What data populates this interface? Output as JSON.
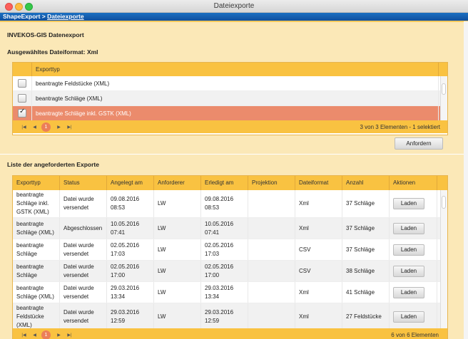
{
  "window": {
    "title": "Dateiexporte"
  },
  "breadcrumb": {
    "root": "ShapeExport",
    "sep": " > ",
    "current": "Dateiexporte"
  },
  "export": {
    "title": "INVEKOS-GIS Datenexport",
    "format_label": "Ausgewähltes Dateiformat: Xml",
    "column_header": "Exporttyp",
    "items": [
      {
        "label": "beantragte Feldstücke (XML)",
        "checked": false
      },
      {
        "label": "beantragte Schläge (XML)",
        "checked": false
      },
      {
        "label": "beantragte Schläge inkl. GSTK (XML)",
        "checked": true
      }
    ],
    "pager": {
      "current": "1",
      "status": "3 von 3 Elementen - 1 selektiert"
    },
    "request_button": "Anfordern"
  },
  "requests": {
    "title": "Liste der angeforderten Exporte",
    "columns": [
      "Exporttyp",
      "Status",
      "Angelegt am",
      "Anforderer",
      "Erledigt am",
      "Projektion",
      "Dateiformat",
      "Anzahl",
      "Aktionen"
    ],
    "action_label": "Laden",
    "rows": [
      {
        "type": "beantragte Schläge inkl. GSTK (XML)",
        "status": "Datei wurde versendet",
        "created": "09.08.2016 08:53",
        "requester": "LW",
        "done": "09.08.2016 08:53",
        "projection": "",
        "format": "Xml",
        "count": "37 Schläge"
      },
      {
        "type": "beantragte Schläge (XML)",
        "status": "Abgeschlossen",
        "created": "10.05.2016 07:41",
        "requester": "LW",
        "done": "10.05.2016 07:41",
        "projection": "",
        "format": "Xml",
        "count": "37 Schläge"
      },
      {
        "type": "beantragte Schläge",
        "status": "Datei wurde versendet",
        "created": "02.05.2016 17:03",
        "requester": "LW",
        "done": "02.05.2016 17:03",
        "projection": "",
        "format": "CSV",
        "count": "37 Schläge"
      },
      {
        "type": "beantragte Schläge",
        "status": "Datei wurde versendet",
        "created": "02.05.2016 17:00",
        "requester": "LW",
        "done": "02.05.2016 17:00",
        "projection": "",
        "format": "CSV",
        "count": "38 Schläge"
      },
      {
        "type": "beantragte Schläge (XML)",
        "status": "Datei wurde versendet",
        "created": "29.03.2016 13:34",
        "requester": "LW",
        "done": "29.03.2016 13:34",
        "projection": "",
        "format": "Xml",
        "count": "41 Schläge"
      },
      {
        "type": "beantragte Feldstücke (XML)",
        "status": "Datei wurde versendet",
        "created": "29.03.2016 12:59",
        "requester": "LW",
        "done": "29.03.2016 12:59",
        "projection": "",
        "format": "Xml",
        "count": "27 Feldstücke"
      }
    ],
    "pager": {
      "current": "1",
      "status": "6 von 6 Elementen"
    }
  },
  "icons": {
    "first": "first-page-icon",
    "prev": "prev-page-icon",
    "next": "next-page-icon",
    "last": "last-page-icon",
    "check": "checkmark-icon"
  }
}
